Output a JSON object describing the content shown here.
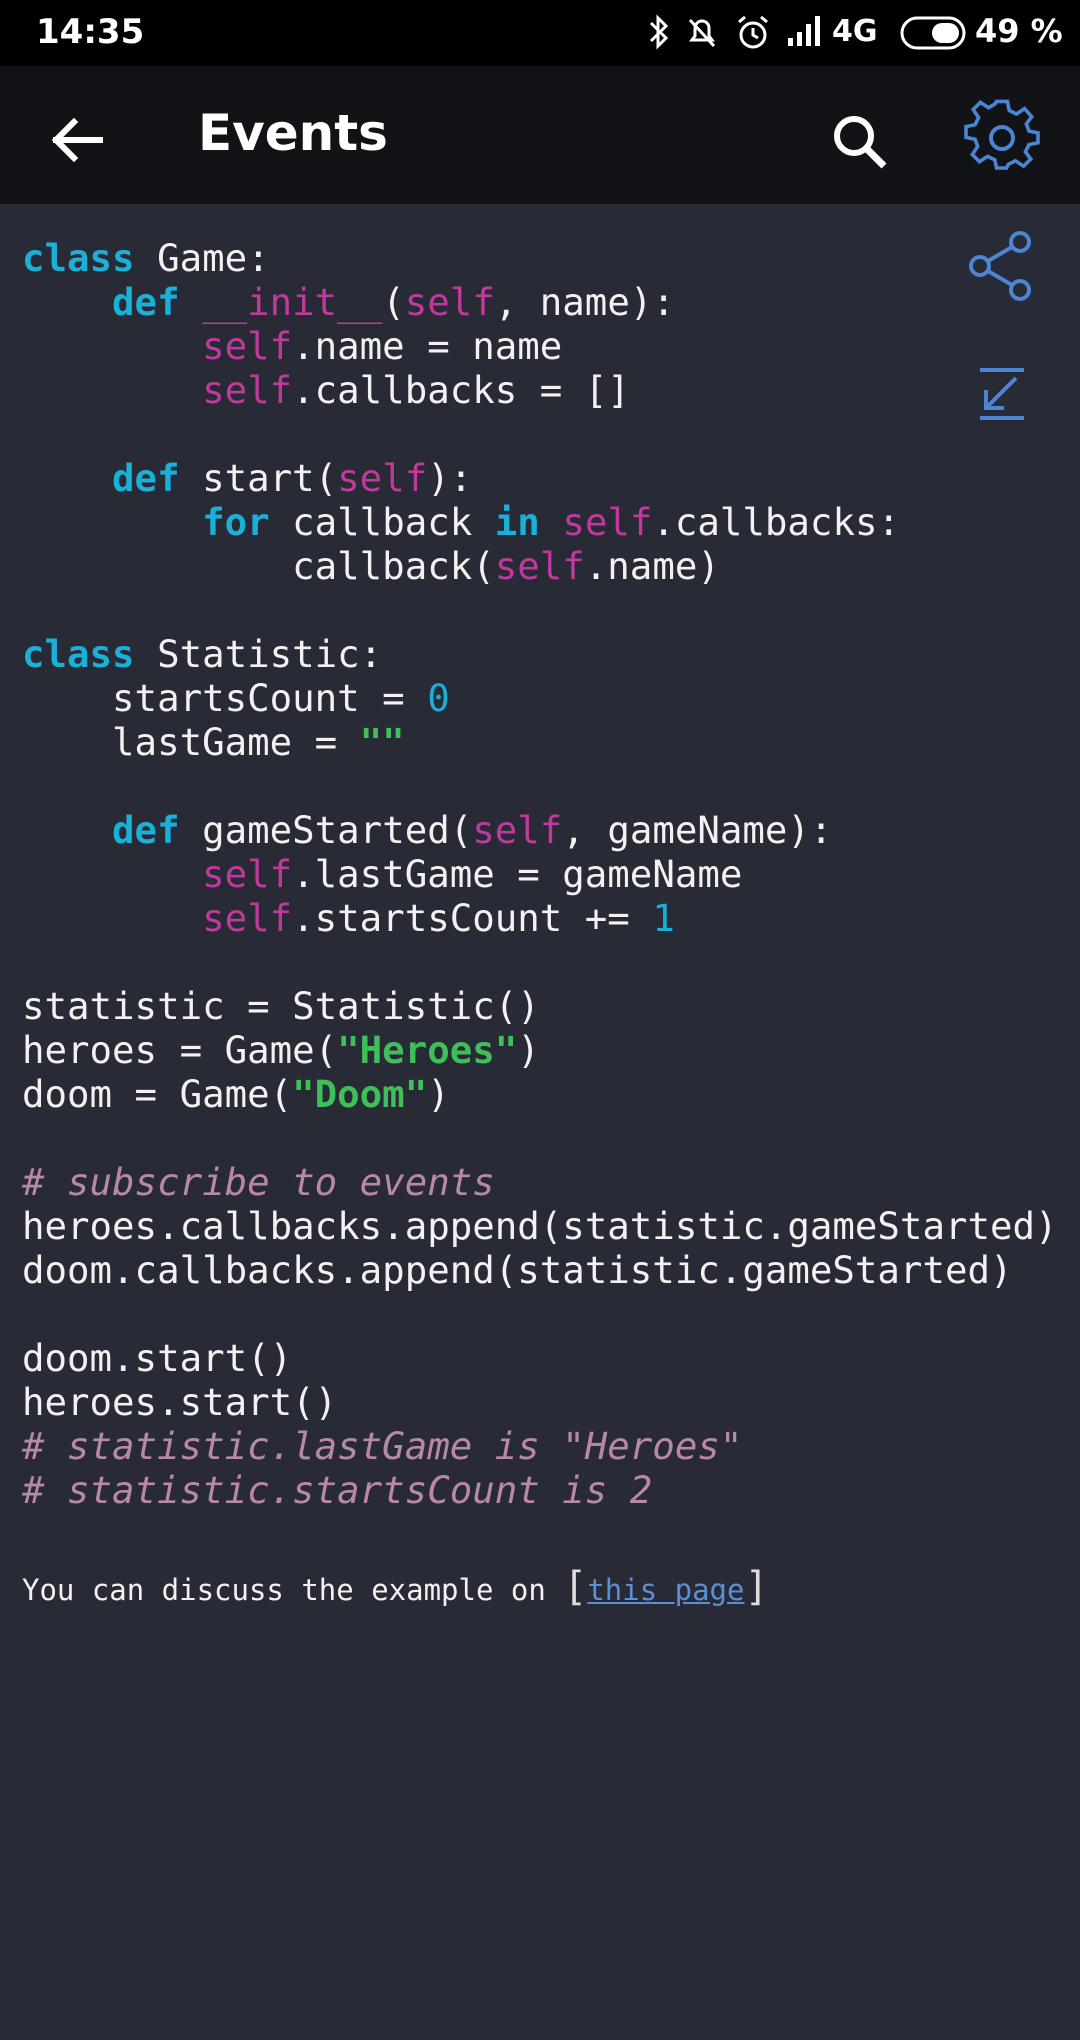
{
  "status_bar": {
    "time": "14:35",
    "network": "4G",
    "battery": "49 %"
  },
  "app_bar": {
    "title": "Events"
  },
  "code_lines": [
    [
      [
        "kw",
        "class"
      ],
      [
        "t",
        " Game:"
      ]
    ],
    [
      [
        "t",
        "    "
      ],
      [
        "kw",
        "def"
      ],
      [
        "t",
        " "
      ],
      [
        "self",
        "__init__"
      ],
      [
        "t",
        "("
      ],
      [
        "self",
        "self"
      ],
      [
        "t",
        ", name):"
      ]
    ],
    [
      [
        "t",
        "        "
      ],
      [
        "self",
        "self"
      ],
      [
        "t",
        ".name = name"
      ]
    ],
    [
      [
        "t",
        "        "
      ],
      [
        "self",
        "self"
      ],
      [
        "t",
        ".callbacks = []"
      ]
    ],
    [],
    [
      [
        "t",
        "    "
      ],
      [
        "kw",
        "def"
      ],
      [
        "t",
        " start("
      ],
      [
        "self",
        "self"
      ],
      [
        "t",
        "):"
      ]
    ],
    [
      [
        "t",
        "        "
      ],
      [
        "kw",
        "for"
      ],
      [
        "t",
        " callback "
      ],
      [
        "kw",
        "in"
      ],
      [
        "t",
        " "
      ],
      [
        "self",
        "self"
      ],
      [
        "t",
        ".callbacks:"
      ]
    ],
    [
      [
        "t",
        "            callback("
      ],
      [
        "self",
        "self"
      ],
      [
        "t",
        ".name)"
      ]
    ],
    [],
    [
      [
        "kw",
        "class"
      ],
      [
        "t",
        " Statistic:"
      ]
    ],
    [
      [
        "t",
        "    startsCount = "
      ],
      [
        "num",
        "0"
      ]
    ],
    [
      [
        "t",
        "    lastGame = "
      ],
      [
        "str",
        "\"\""
      ]
    ],
    [],
    [
      [
        "t",
        "    "
      ],
      [
        "kw",
        "def"
      ],
      [
        "t",
        " gameStarted("
      ],
      [
        "self",
        "self"
      ],
      [
        "t",
        ", gameName):"
      ]
    ],
    [
      [
        "t",
        "        "
      ],
      [
        "self",
        "self"
      ],
      [
        "t",
        ".lastGame = gameName"
      ]
    ],
    [
      [
        "t",
        "        "
      ],
      [
        "self",
        "self"
      ],
      [
        "t",
        ".startsCount += "
      ],
      [
        "num",
        "1"
      ]
    ],
    [],
    [
      [
        "t",
        "statistic = Statistic()"
      ]
    ],
    [
      [
        "t",
        "heroes = Game("
      ],
      [
        "str",
        "\"Heroes\""
      ],
      [
        "t",
        ")"
      ]
    ],
    [
      [
        "t",
        "doom = Game("
      ],
      [
        "str",
        "\"Doom\""
      ],
      [
        "t",
        ")"
      ]
    ],
    [],
    [
      [
        "cm",
        "# subscribe to events"
      ]
    ],
    [
      [
        "t",
        "heroes.callbacks.append(statistic.gameStarted)"
      ]
    ],
    [
      [
        "t",
        "doom.callbacks.append(statistic.gameStarted)"
      ]
    ],
    [],
    [
      [
        "t",
        "doom.start()"
      ]
    ],
    [
      [
        "t",
        "heroes.start()"
      ]
    ],
    [
      [
        "cm",
        "# statistic.lastGame is \"Heroes\""
      ]
    ],
    [
      [
        "cm",
        "# statistic.startsCount is 2"
      ]
    ]
  ],
  "footer": {
    "text": "You can discuss the example on ",
    "link_text": "this page"
  },
  "icons": {
    "back": "arrow-left-icon",
    "search": "search-icon",
    "settings": "gear-icon",
    "share": "share-icon",
    "collapse": "arrow-down-left-icon"
  },
  "colors": {
    "background": "#282a36",
    "app_bar": "#121316",
    "keyword": "#1ab0d8",
    "self": "#c0399c",
    "string": "#3fbf5a",
    "comment": "#b889a6",
    "accent": "#4a86d4"
  }
}
